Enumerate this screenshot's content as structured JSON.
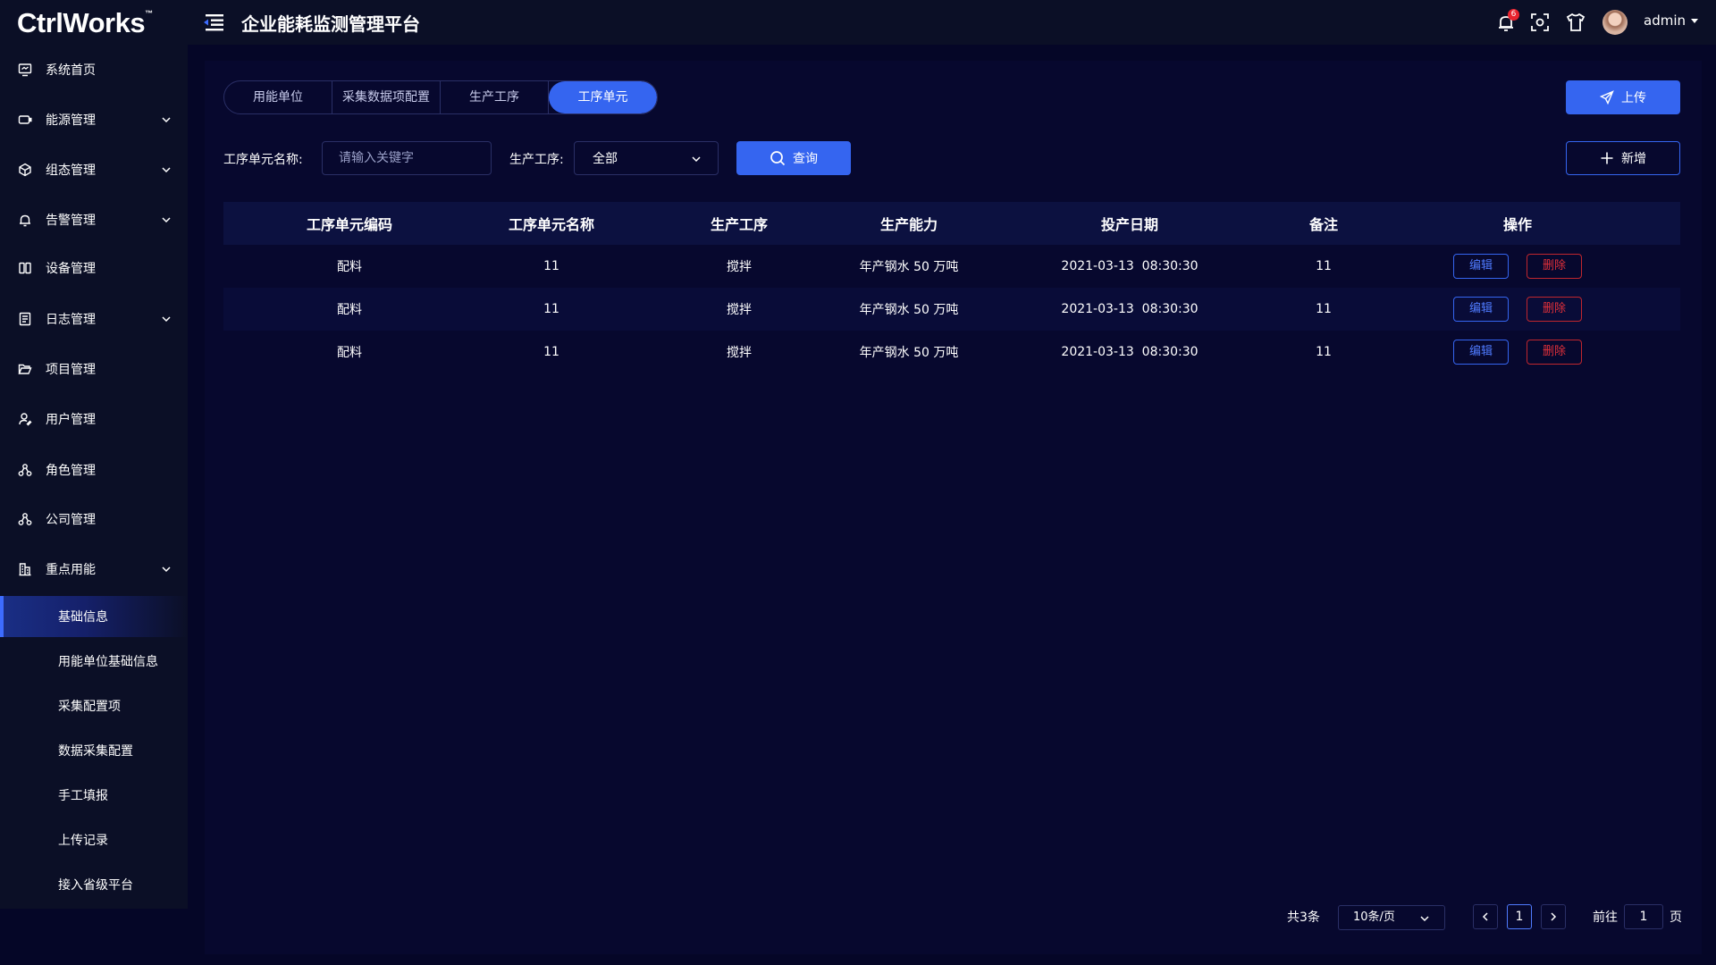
{
  "header": {
    "logo": "CtrlWorks",
    "logo_mark": "™",
    "title": "企业能耗监测管理平台",
    "notification_count": "6",
    "username": "admin"
  },
  "sidebar": {
    "items": [
      {
        "label": "系统首页",
        "icon": "monitor-icon",
        "expandable": false
      },
      {
        "label": "能源管理",
        "icon": "battery-icon",
        "expandable": true
      },
      {
        "label": "组态管理",
        "icon": "cube-icon",
        "expandable": true
      },
      {
        "label": "告警管理",
        "icon": "bell-icon",
        "expandable": true
      },
      {
        "label": "设备管理",
        "icon": "device-icon",
        "expandable": false
      },
      {
        "label": "日志管理",
        "icon": "log-icon",
        "expandable": true
      },
      {
        "label": "项目管理",
        "icon": "folder-icon",
        "expandable": false
      },
      {
        "label": "用户管理",
        "icon": "user-icon",
        "expandable": false
      },
      {
        "label": "角色管理",
        "icon": "role-icon",
        "expandable": false
      },
      {
        "label": "公司管理",
        "icon": "company-icon",
        "expandable": false
      },
      {
        "label": "重点用能",
        "icon": "building-icon",
        "expandable": true
      }
    ],
    "sub_items": [
      {
        "label": "基础信息",
        "active": true
      },
      {
        "label": "用能单位基础信息",
        "active": false
      },
      {
        "label": "采集配置项",
        "active": false
      },
      {
        "label": "数据采集配置",
        "active": false
      },
      {
        "label": "手工填报",
        "active": false
      },
      {
        "label": "上传记录",
        "active": false
      },
      {
        "label": "接入省级平台",
        "active": false
      }
    ]
  },
  "tabs": [
    {
      "label": "用能单位",
      "active": false
    },
    {
      "label": "采集数据项配置",
      "active": false
    },
    {
      "label": "生产工序",
      "active": false
    },
    {
      "label": "工序单元",
      "active": true
    }
  ],
  "actions": {
    "upload_label": "上传",
    "add_label": "新增",
    "query_label": "查询"
  },
  "filters": {
    "name_label": "工序单元名称:",
    "name_placeholder": "请输入关键字",
    "process_label": "生产工序:",
    "process_value": "全部"
  },
  "table": {
    "columns": [
      "工序单元编码",
      "工序单元名称",
      "生产工序",
      "生产能力",
      "投产日期",
      "备注",
      "操作"
    ],
    "rows": [
      {
        "code": "配料",
        "name": "11",
        "process": "搅拌",
        "capacity": "年产钢水 50 万吨",
        "date": "2021-03-13  08:30:30",
        "note": "11"
      },
      {
        "code": "配料",
        "name": "11",
        "process": "搅拌",
        "capacity": "年产钢水 50 万吨",
        "date": "2021-03-13  08:30:30",
        "note": "11"
      },
      {
        "code": "配料",
        "name": "11",
        "process": "搅拌",
        "capacity": "年产钢水 50 万吨",
        "date": "2021-03-13  08:30:30",
        "note": "11"
      }
    ],
    "edit_label": "编辑",
    "delete_label": "删除"
  },
  "pagination": {
    "total": "共3条",
    "page_size": "10条/页",
    "current_page": "1",
    "goto_prefix": "前往",
    "goto_value": "1",
    "goto_suffix": "页"
  },
  "colors": {
    "accent": "#3565f0",
    "danger": "#e0303a",
    "background": "#050627",
    "panel": "#07082e"
  }
}
